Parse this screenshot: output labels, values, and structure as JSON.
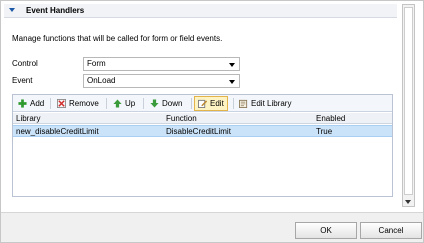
{
  "section": {
    "title": "Event Handlers"
  },
  "description": "Manage functions that will be called for form or field events.",
  "control": {
    "label": "Control",
    "value": "Form"
  },
  "event": {
    "label": "Event",
    "value": "OnLoad"
  },
  "toolbar": {
    "add": "Add",
    "remove": "Remove",
    "up": "Up",
    "down": "Down",
    "edit": "Edit",
    "edit_library": "Edit Library"
  },
  "grid": {
    "columns": [
      "Library",
      "Function",
      "Enabled"
    ],
    "rows": [
      [
        "new_disableCreditLimit",
        "DisableCreditLimit",
        "True"
      ]
    ]
  },
  "footer": {
    "ok": "OK",
    "cancel": "Cancel"
  },
  "colors": {
    "accent": "#1a57a7",
    "selected_row": "#cbe3f8",
    "edit_active": "#fdf3c3"
  }
}
